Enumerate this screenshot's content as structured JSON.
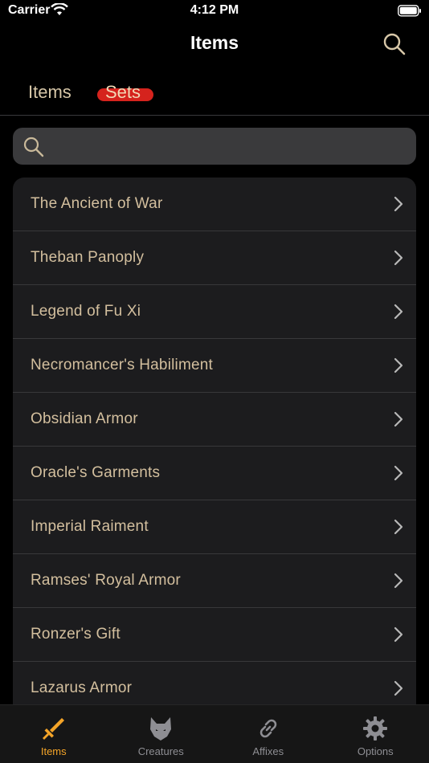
{
  "status": {
    "carrier": "Carrier",
    "time": "4:12 PM"
  },
  "nav": {
    "title": "Items"
  },
  "segments": {
    "items": "Items",
    "sets": "Sets",
    "active": "Sets"
  },
  "search": {
    "placeholder": "",
    "value": ""
  },
  "list": {
    "items": [
      "The Ancient of War",
      "Theban Panoply",
      "Legend of Fu Xi",
      "Necromancer's Habiliment",
      "Obsidian Armor",
      "Oracle's Garments",
      "Imperial Raiment",
      "Ramses' Royal Armor",
      "Ronzer's Gift",
      "Lazarus Armor"
    ]
  },
  "tabs": [
    {
      "label": "Items",
      "icon": "sword-icon",
      "active": true
    },
    {
      "label": "Creatures",
      "icon": "wolf-icon",
      "active": false
    },
    {
      "label": "Affixes",
      "icon": "link-icon",
      "active": false
    },
    {
      "label": "Options",
      "icon": "gear-icon",
      "active": false
    }
  ],
  "colors": {
    "accent": "#f4a428",
    "highlight": "#d5231d",
    "row_text": "#d3bf9e",
    "row_bg": "#1c1c1e"
  }
}
